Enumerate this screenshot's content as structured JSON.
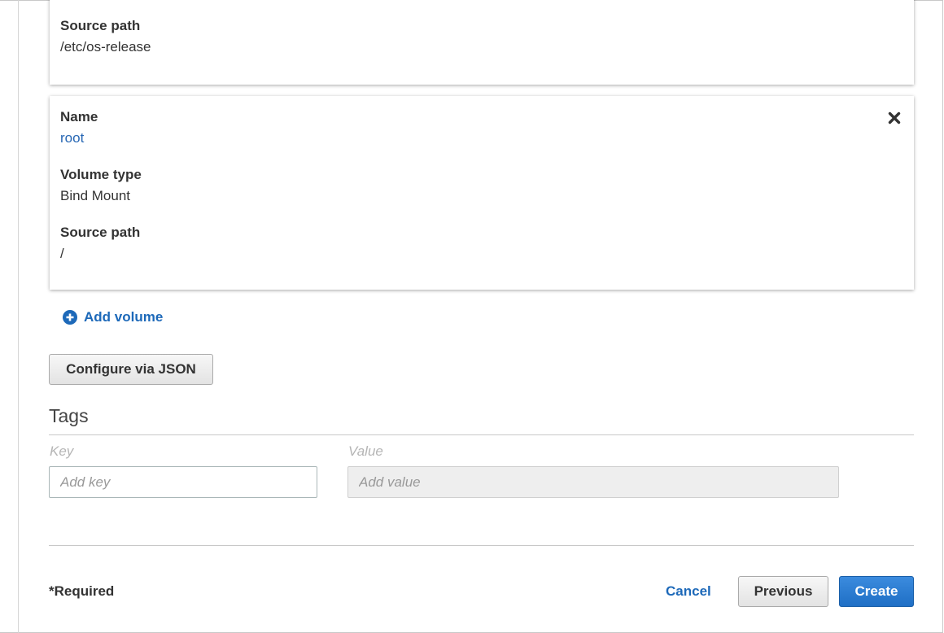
{
  "volumes": [
    {
      "source_path_label": "Source path",
      "source_path_value": "/etc/os-release"
    },
    {
      "name_label": "Name",
      "name_value": "root",
      "volume_type_label": "Volume type",
      "volume_type_value": "Bind Mount",
      "source_path_label": "Source path",
      "source_path_value": "/",
      "remove_icon": "close-x-icon"
    }
  ],
  "add_volume": {
    "icon": "plus-circle-icon",
    "label": "Add volume"
  },
  "configure_json_label": "Configure via JSON",
  "tags": {
    "heading": "Tags",
    "key_header": "Key",
    "value_header": "Value",
    "key_placeholder": "Add key",
    "value_placeholder": "Add value"
  },
  "footer": {
    "required": "*Required",
    "cancel": "Cancel",
    "previous": "Previous",
    "create": "Create"
  },
  "colors": {
    "link": "#1d69b9",
    "primary_button": "#2a7bd4",
    "text": "#333333"
  }
}
